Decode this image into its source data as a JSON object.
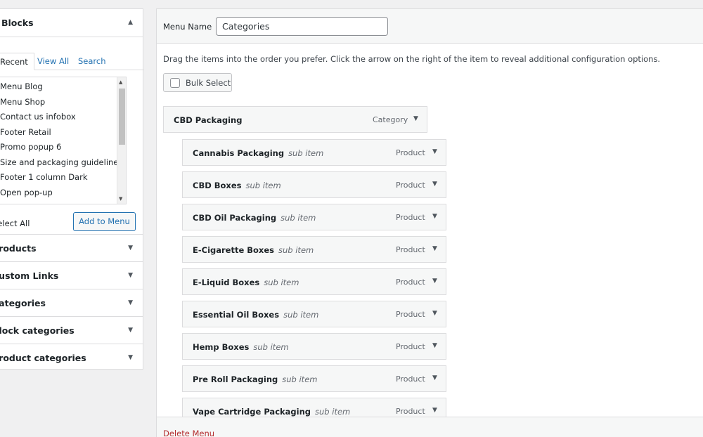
{
  "left_panel": {
    "blocks_title": "Blocks",
    "tabs": {
      "recent": "Recent",
      "view_all": "View All",
      "search": "Search"
    },
    "recent_items": [
      "Menu Blog",
      "Menu Shop",
      "Contact us infobox",
      "Footer Retail",
      "Promo popup 6",
      "Size and packaging guidelines",
      "Footer 1 column Dark",
      "Open pop-up"
    ],
    "select_all": "Select All",
    "add_to_menu": "Add to Menu",
    "sections": [
      {
        "title": "Products"
      },
      {
        "title": "Custom Links"
      },
      {
        "title": "Categories"
      },
      {
        "title": "Block categories"
      },
      {
        "title": "Product categories"
      }
    ]
  },
  "menu": {
    "name_label": "Menu Name",
    "name_value": "Categories",
    "instructions": "Drag the items into the order you prefer. Click the arrow on the right of the item to reveal additional configuration options.",
    "bulk_select": "Bulk Select",
    "parent_item": {
      "title": "CBD Packaging",
      "type": "Category"
    },
    "sub_label": "sub item",
    "sub_items": [
      {
        "title": "Cannabis Packaging",
        "type": "Product"
      },
      {
        "title": "CBD Boxes",
        "type": "Product"
      },
      {
        "title": "CBD Oil Packaging",
        "type": "Product"
      },
      {
        "title": "E-Cigarette Boxes",
        "type": "Product"
      },
      {
        "title": "E-Liquid Boxes",
        "type": "Product"
      },
      {
        "title": "Essential Oil Boxes",
        "type": "Product"
      },
      {
        "title": "Hemp Boxes",
        "type": "Product"
      },
      {
        "title": "Pre Roll Packaging",
        "type": "Product"
      },
      {
        "title": "Vape Cartridge Packaging",
        "type": "Product"
      }
    ],
    "delete_menu": "Delete Menu"
  }
}
